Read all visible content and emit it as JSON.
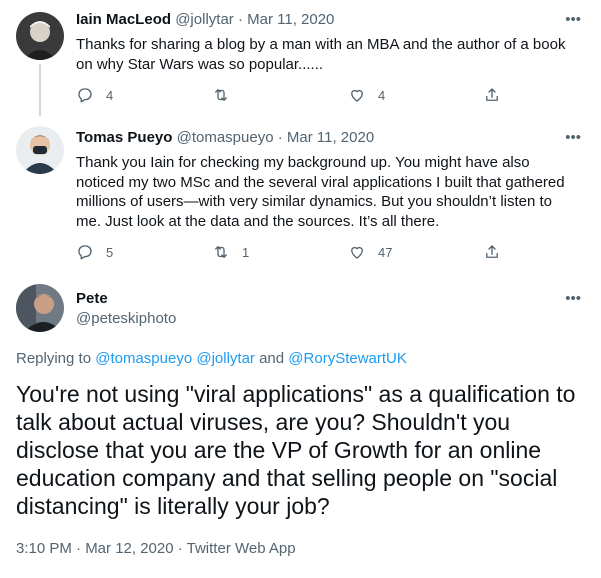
{
  "tweets": [
    {
      "name": "Iain MacLeod",
      "handle": "@jollytar",
      "date": "Mar 11, 2020",
      "text": "Thanks for sharing a blog by a man with an MBA and the author of a book on why Star Wars was so popular......",
      "replies": "4",
      "retweets": "",
      "likes": "4"
    },
    {
      "name": "Tomas Pueyo",
      "handle": "@tomaspueyo",
      "date": "Mar 11, 2020",
      "text": "Thank you Iain for checking my background up. You might have also noticed my two MSc and the several viral applications I built that gathered millions of users—with very similar dynamics. But you shouldn’t listen to me. Just look at the data and the sources. It’s all there.",
      "replies": "5",
      "retweets": "1",
      "likes": "47"
    }
  ],
  "main_tweet": {
    "name": "Pete",
    "handle": "@peteskiphoto",
    "replying_prefix": "Replying to",
    "mentions": [
      "@tomaspueyo",
      "@jollytar",
      "@RoryStewartUK"
    ],
    "mention_separator_1": " ",
    "mention_separator_2": " and ",
    "text": "You're not using \"viral applications\" as a qualification to talk about actual viruses, are you? Shouldn't you disclose that you are the VP of Growth for an online education company and that selling people on \"social distancing\" is literally your job?",
    "timestamp": "3:10 PM · Mar 12, 2020 · Twitter Web App"
  },
  "dot": "·",
  "more_glyph": "•••",
  "icons": {
    "reply": "reply-icon",
    "retweet": "retweet-icon",
    "like": "like-icon",
    "share": "share-icon",
    "more": "more-options-icon"
  },
  "colors": {
    "text": "#0f1419",
    "secondary": "#536471",
    "link": "#1d9bf0",
    "thread_line": "#cfd9de"
  }
}
